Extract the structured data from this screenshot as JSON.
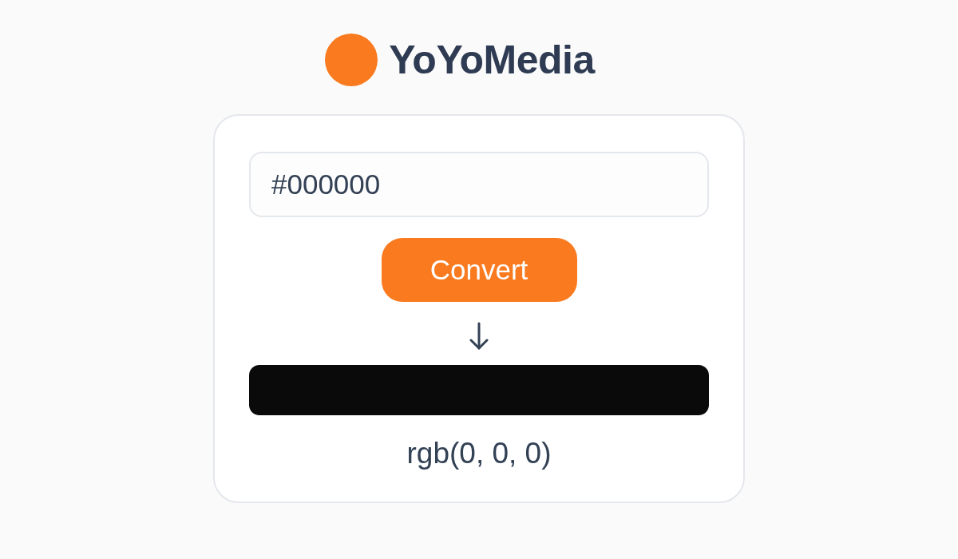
{
  "brand": {
    "name": "YoYoMedia"
  },
  "converter": {
    "input": {
      "value": "#000000"
    },
    "button": {
      "label": "Convert"
    },
    "result": {
      "color": "#0a0a0a",
      "text": "rgb(0, 0, 0)"
    }
  }
}
